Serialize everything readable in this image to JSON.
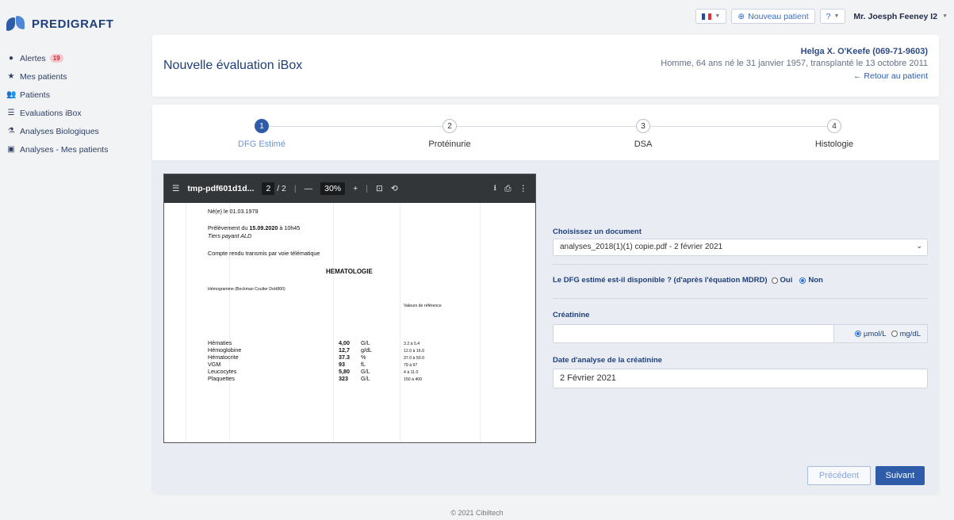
{
  "app": {
    "name": "PREDIGRAFT"
  },
  "topbar": {
    "new_patient": "Nouveau patient",
    "user": "Mr. Joesph Feeney I2"
  },
  "sidebar": {
    "items": [
      {
        "label": "Alertes",
        "icon": "alert-circle-icon",
        "badge": "19"
      },
      {
        "label": "Mes patients",
        "icon": "star-icon"
      },
      {
        "label": "Patients",
        "icon": "users-icon"
      },
      {
        "label": "Evaluations iBox",
        "icon": "list-icon"
      },
      {
        "label": "Analyses Biologiques",
        "icon": "test-tube-icon"
      },
      {
        "label": "Analyses - Mes patients",
        "icon": "document-star-icon"
      }
    ]
  },
  "header": {
    "title": "Nouvelle évaluation iBox",
    "patient_name": "Helga X. O'Keefe (069-71-9603)",
    "patient_info": "Homme, 64 ans né le 31 janvier 1957, transplanté le 13 octobre 2011",
    "back": "← Retour au patient"
  },
  "steps": [
    {
      "num": "1",
      "label": "DFG Estimé",
      "active": true
    },
    {
      "num": "2",
      "label": "Protéinurie"
    },
    {
      "num": "3",
      "label": "DSA"
    },
    {
      "num": "4",
      "label": "Histologie"
    }
  ],
  "pdf": {
    "filename": "tmp-pdf601d1d...",
    "page": "2",
    "pages": "/ 2",
    "zoom": "30%",
    "lines": {
      "born": "Né(e) le 01.03.1979",
      "sample_prefix": "Prélèvement du ",
      "sample_date": "15.09.2020",
      "sample_suffix": " à 10h45",
      "payer": "Tiers payant ALD",
      "transmit": "Compte rendu transmis par voie télématique",
      "section": "HEMATOLOGIE",
      "device": "Hémogramme (Beckman Coulter DxH800)",
      "ref_header": "Valeurs de référence"
    },
    "rows": [
      {
        "name": "Hématies",
        "value": "4,00",
        "unit": "G/L",
        "ref": "3.2 à 5.4"
      },
      {
        "name": "Hémoglobine",
        "value": "12,7",
        "unit": "g/dL",
        "ref": "12.0 à 16.0"
      },
      {
        "name": "Hématocrite",
        "value": "37.3",
        "unit": "%",
        "ref": "37.0 à 50.0"
      },
      {
        "name": "VGM",
        "value": "93",
        "unit": "fL",
        "ref": "79 à 97"
      },
      {
        "name": "Leucocytes",
        "value": "5,80",
        "unit": "G/L",
        "ref": "4 à 11.0"
      },
      {
        "name": "Plaquettes",
        "value": "323",
        "unit": "G/L",
        "ref": "150 à 400"
      }
    ]
  },
  "form": {
    "doc_label": "Choisissez un document",
    "doc_value": "analyses_2018(1)(1) copie.pdf - 2 février 2021",
    "dfg_question": "Le DFG estimé est-il disponible ? (d'après l'équation MDRD)",
    "yes": "Oui",
    "no": "Non",
    "creat_label": "Créatinine",
    "unit_umol": "µmol/L",
    "unit_mgdl": "mg/dL",
    "date_label": "Date d'analyse de la créatinine",
    "date_value": "2 Février 2021"
  },
  "buttons": {
    "prev": "Précédent",
    "next": "Suivant"
  },
  "footer": "© 2021 Cibiltech"
}
